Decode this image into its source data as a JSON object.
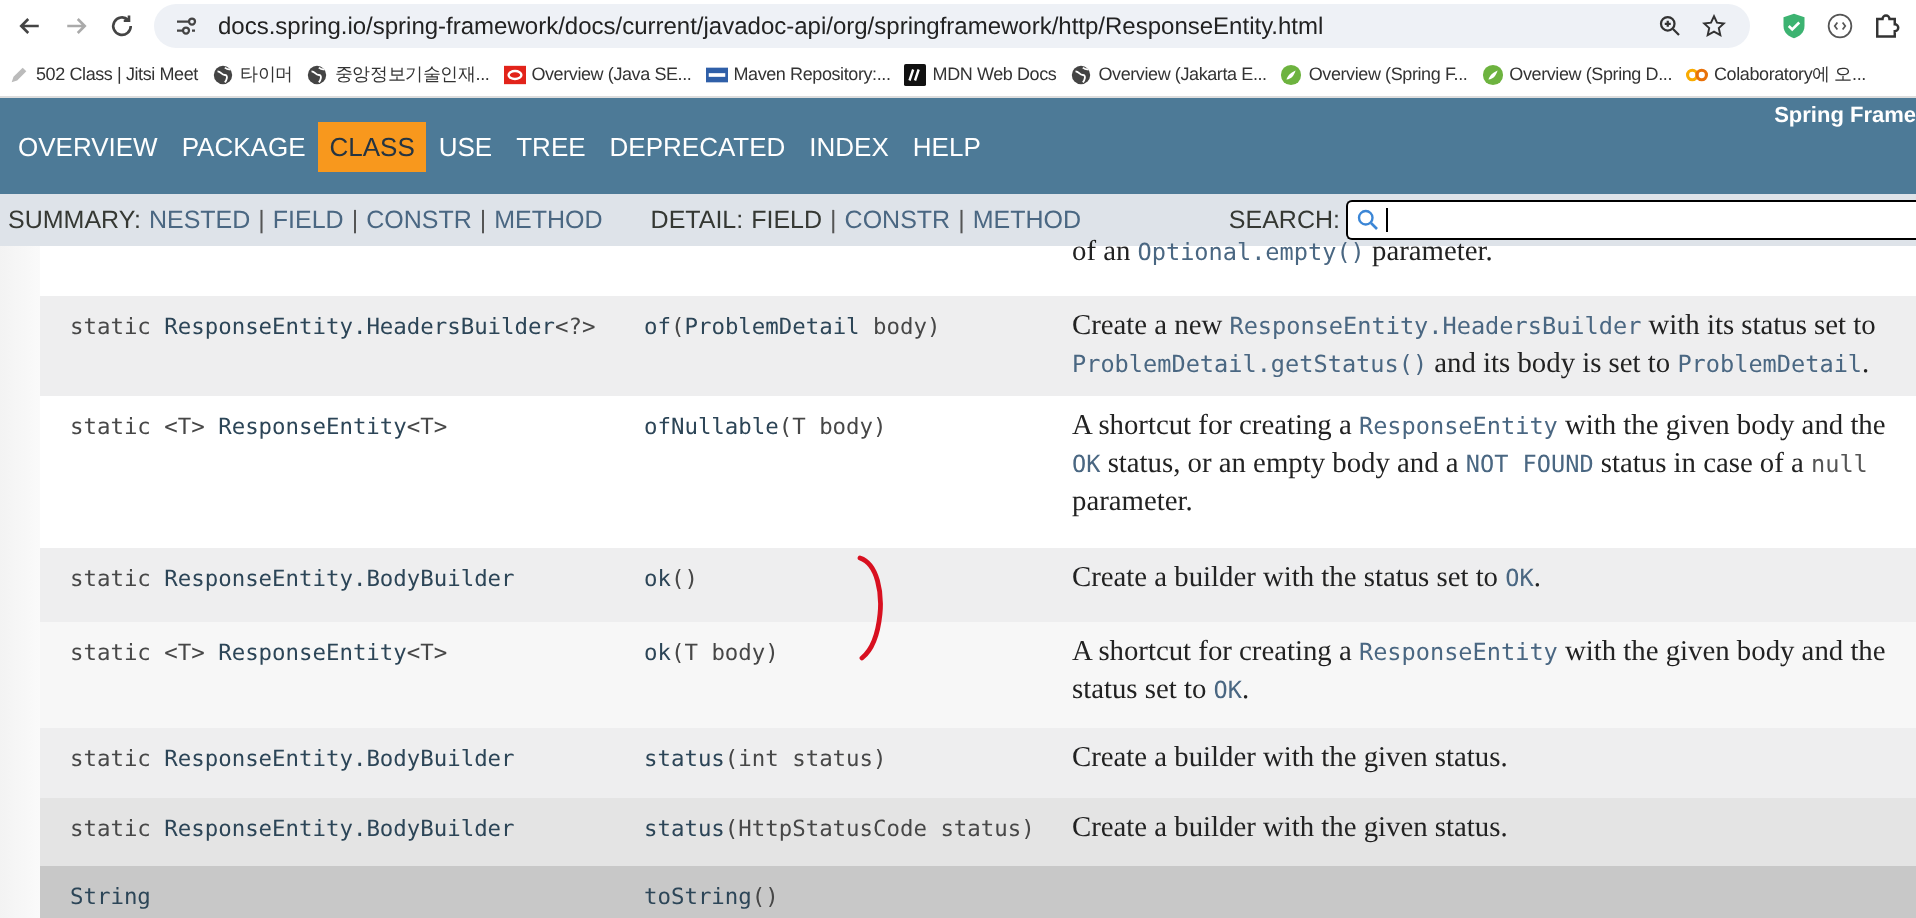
{
  "browser": {
    "url": "docs.spring.io/spring-framework/docs/current/javadoc-api/org/springframework/http/ResponseEntity.html",
    "bookmarks": [
      {
        "label": "502 Class | Jitsi Meet",
        "kind": "pen"
      },
      {
        "label": "타이머",
        "kind": "globe"
      },
      {
        "label": "중앙정보기술인재...",
        "kind": "globe"
      },
      {
        "label": "Overview (Java SE...",
        "kind": "oracle"
      },
      {
        "label": "Maven Repository:...",
        "kind": "maven"
      },
      {
        "label": "MDN Web Docs",
        "kind": "mdn"
      },
      {
        "label": "Overview (Jakarta E...",
        "kind": "globe"
      },
      {
        "label": "Overview (Spring F...",
        "kind": "spring"
      },
      {
        "label": "Overview (Spring D...",
        "kind": "spring"
      },
      {
        "label": "Colaboratory에 오...",
        "kind": "colab"
      }
    ]
  },
  "nav": {
    "items": [
      {
        "label": "OVERVIEW",
        "selected": false
      },
      {
        "label": "PACKAGE",
        "selected": false
      },
      {
        "label": "CLASS",
        "selected": true
      },
      {
        "label": "USE",
        "selected": false
      },
      {
        "label": "TREE",
        "selected": false
      },
      {
        "label": "DEPRECATED",
        "selected": false
      },
      {
        "label": "INDEX",
        "selected": false
      },
      {
        "label": "HELP",
        "selected": false
      }
    ],
    "title": "Spring Frame"
  },
  "subnav": {
    "separator": "|",
    "summary_label": "SUMMARY:",
    "summary": [
      {
        "label": "NESTED",
        "kind": "link"
      },
      {
        "label": "FIELD",
        "kind": "link"
      },
      {
        "label": "CONSTR",
        "kind": "link"
      },
      {
        "label": "METHOD",
        "kind": "link"
      }
    ],
    "detail_label": "DETAIL:",
    "detail": [
      {
        "label": "FIELD",
        "kind": "text"
      },
      {
        "label": "CONSTR",
        "kind": "link"
      },
      {
        "label": "METHOD",
        "kind": "link"
      }
    ],
    "search_label": "SEARCH:"
  },
  "rows": [
    {
      "type": [],
      "method": [],
      "description": [
        {
          "text": "of an ",
          "kind": "plain"
        },
        {
          "text": "Optional.empty()",
          "kind": "code"
        },
        {
          "text": " parameter.",
          "kind": "plain"
        }
      ]
    },
    {
      "type": [
        {
          "text": "static ",
          "kind": "plain"
        },
        {
          "text": "ResponseEntity.HeadersBuilder",
          "kind": "link"
        },
        {
          "text": "<?>",
          "kind": "plain"
        }
      ],
      "method": [
        {
          "text": "of",
          "kind": "link"
        },
        {
          "text": "(",
          "kind": "plain"
        },
        {
          "text": "ProblemDetail",
          "kind": "link"
        },
        {
          "text": " body)",
          "kind": "plain"
        }
      ],
      "description": [
        {
          "text": "Create a new ",
          "kind": "plain"
        },
        {
          "text": "ResponseEntity.HeadersBuilder",
          "kind": "code"
        },
        {
          "text": " with its status set to ",
          "kind": "plain"
        },
        {
          "text": "ProblemDetail.getStatus()",
          "kind": "code"
        },
        {
          "text": " and its body is set to ",
          "kind": "plain"
        },
        {
          "text": "ProblemDetail",
          "kind": "code"
        },
        {
          "text": ".",
          "kind": "plain"
        }
      ]
    },
    {
      "type": [
        {
          "text": "static <T> ",
          "kind": "plain"
        },
        {
          "text": "ResponseEntity",
          "kind": "link"
        },
        {
          "text": "<T>",
          "kind": "plain"
        }
      ],
      "method": [
        {
          "text": "ofNullable",
          "kind": "link"
        },
        {
          "text": "(T body)",
          "kind": "plain"
        }
      ],
      "description": [
        {
          "text": "A shortcut for creating a ",
          "kind": "plain"
        },
        {
          "text": "ResponseEntity",
          "kind": "code"
        },
        {
          "text": " with the given body and the ",
          "kind": "plain"
        },
        {
          "text": "OK",
          "kind": "code"
        },
        {
          "text": " status, or an empty body and a ",
          "kind": "plain"
        },
        {
          "text": "NOT FOUND",
          "kind": "code"
        },
        {
          "text": " status in case of a ",
          "kind": "plain"
        },
        {
          "text": "null",
          "kind": "mono"
        },
        {
          "text": " parameter.",
          "kind": "plain"
        }
      ]
    },
    {
      "type": [
        {
          "text": "static ",
          "kind": "plain"
        },
        {
          "text": "ResponseEntity.BodyBuilder",
          "kind": "link"
        }
      ],
      "method": [
        {
          "text": "ok",
          "kind": "link"
        },
        {
          "text": "()",
          "kind": "plain"
        }
      ],
      "description": [
        {
          "text": "Create a builder with the status set to ",
          "kind": "plain"
        },
        {
          "text": "OK",
          "kind": "code"
        },
        {
          "text": ".",
          "kind": "plain"
        }
      ]
    },
    {
      "type": [
        {
          "text": "static <T> ",
          "kind": "plain"
        },
        {
          "text": "ResponseEntity",
          "kind": "link"
        },
        {
          "text": "<T>",
          "kind": "plain"
        }
      ],
      "method": [
        {
          "text": "ok",
          "kind": "link"
        },
        {
          "text": "(T body)",
          "kind": "plain"
        }
      ],
      "description": [
        {
          "text": "A shortcut for creating a ",
          "kind": "plain"
        },
        {
          "text": "ResponseEntity",
          "kind": "code"
        },
        {
          "text": " with the given body and the status set to ",
          "kind": "plain"
        },
        {
          "text": "OK",
          "kind": "code"
        },
        {
          "text": ".",
          "kind": "plain"
        }
      ]
    },
    {
      "type": [
        {
          "text": "static ",
          "kind": "plain"
        },
        {
          "text": "ResponseEntity.BodyBuilder",
          "kind": "link"
        }
      ],
      "method": [
        {
          "text": "status",
          "kind": "link"
        },
        {
          "text": "(int status)",
          "kind": "plain"
        }
      ],
      "description": [
        {
          "text": "Create a builder with the given status.",
          "kind": "plain"
        }
      ]
    },
    {
      "type": [
        {
          "text": "static ",
          "kind": "plain"
        },
        {
          "text": "ResponseEntity.BodyBuilder",
          "kind": "link"
        }
      ],
      "method": [
        {
          "text": "status",
          "kind": "link"
        },
        {
          "text": "(HttpStatusCode status)",
          "kind": "plain"
        }
      ],
      "description": [
        {
          "text": "Create a builder with the given status.",
          "kind": "plain"
        }
      ]
    },
    {
      "type": [
        {
          "text": "String",
          "kind": "link"
        }
      ],
      "method": [
        {
          "text": "toString",
          "kind": "link"
        },
        {
          "text": "()",
          "kind": "plain"
        }
      ],
      "description": []
    }
  ]
}
